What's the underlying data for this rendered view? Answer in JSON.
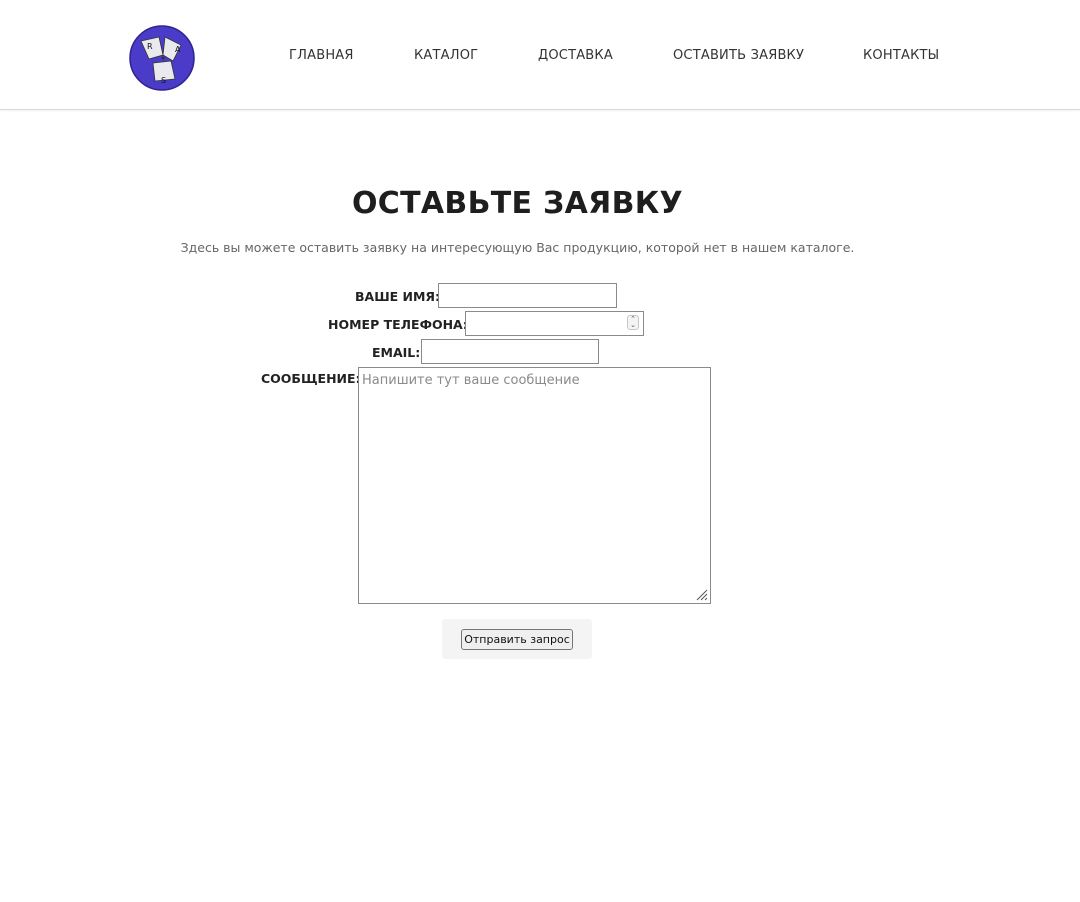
{
  "header": {
    "logo": {
      "letters": [
        "R",
        "A",
        "S"
      ],
      "color": "#4a3cc8"
    },
    "nav": [
      {
        "label": "ГЛАВНАЯ"
      },
      {
        "label": "КАТАЛОГ"
      },
      {
        "label": "ДОСТАВКА"
      },
      {
        "label": "ОСТАВИТЬ ЗАЯВКУ"
      },
      {
        "label": "КОНТАКТЫ"
      }
    ]
  },
  "main": {
    "title": "ОСТАВЬТЕ ЗАЯВКУ",
    "subtitle": "Здесь вы можете оставить заявку на интересующую Вас продукцию, которой нет в нашем каталоге."
  },
  "form": {
    "name_label": "ВАШЕ ИМЯ:",
    "name_value": "",
    "phone_label": "НОМЕР ТЕЛЕФОНА:",
    "phone_value": "",
    "email_label": "EMAIL:",
    "email_value": "",
    "message_label": "СООБЩЕНИЕ:",
    "message_placeholder": "Напишите тут ваше сообщение",
    "submit_label": "Отправить запрос"
  }
}
